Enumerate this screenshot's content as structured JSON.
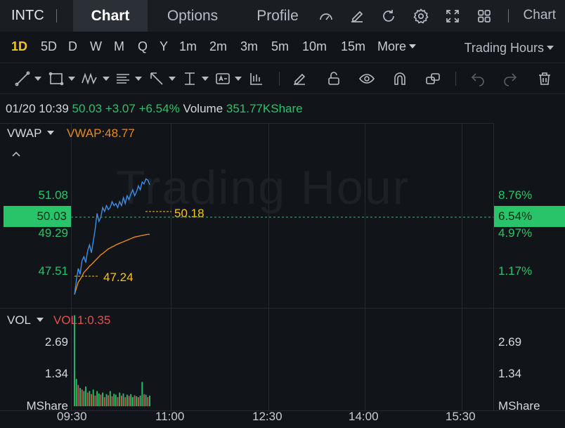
{
  "header": {
    "ticker": "INTC",
    "tabs": [
      {
        "label": "Chart",
        "active": true
      },
      {
        "label": "Options",
        "active": false
      },
      {
        "label": "Profile",
        "active": false
      }
    ],
    "right_label": "Chart",
    "icons": [
      "gauge-icon",
      "edit-icon",
      "refresh-icon",
      "settings-icon",
      "fullscreen-icon",
      "grid-icon"
    ]
  },
  "periods": {
    "items": [
      "1D",
      "5D",
      "D",
      "W",
      "M",
      "Q",
      "Y",
      "1m",
      "2m",
      "3m",
      "5m",
      "10m",
      "15m"
    ],
    "active": "1D",
    "more_label": "More",
    "session_label": "Trading Hours"
  },
  "quote": {
    "datetime": "01/20 10:39",
    "price": "50.03",
    "change": "+3.07",
    "change_pct": "+6.54%",
    "volume_label": "Volume",
    "volume": "351.77KShare"
  },
  "price_panel": {
    "indicator": "VWAP",
    "indicator_value": "VWAP:48.77",
    "watermark": "Trading Hour",
    "left_axis": [
      "51.08",
      "49.29",
      "47.51"
    ],
    "right_axis": [
      "8.76%",
      "4.97%",
      "1.17%"
    ],
    "current_price": "50.03",
    "current_pct": "6.54%",
    "high_marker": "50.18",
    "low_marker": "47.24"
  },
  "volume_panel": {
    "indicator": "VOL",
    "indicator_value": "VOL1:0.35",
    "left_axis": [
      "2.69",
      "1.34",
      "MShare"
    ],
    "right_axis": [
      "2.69",
      "1.34",
      "MShare"
    ]
  },
  "time_axis": [
    "09:30",
    "11:00",
    "12:30",
    "14:00",
    "15:30"
  ],
  "colors": {
    "up": "#29c46a",
    "down": "#e0524f",
    "price_line": "#3b8ee8",
    "vwap_line": "#e88a1a",
    "marker": "#f5c518",
    "active_period": "#f5c518"
  },
  "chart_data": {
    "type": "line",
    "price_range": [
      46.9,
      51.6
    ],
    "volume_range": [
      0,
      3.2
    ],
    "series": [
      {
        "key": "price",
        "values": [
          47.24,
          47.6,
          47.9,
          47.75,
          48.1,
          48.2,
          48.05,
          48.35,
          48.5,
          48.3,
          48.6,
          48.9,
          49.3,
          49.1,
          49.2,
          49.45,
          49.35,
          49.5,
          49.4,
          49.45,
          49.6,
          49.5,
          49.55,
          49.45,
          49.6,
          49.5,
          49.7,
          49.55,
          49.75,
          49.65,
          49.8,
          49.9,
          49.75,
          49.85,
          50.0,
          49.9,
          50.1,
          50.05,
          50.18,
          50.15,
          50.03
        ]
      },
      {
        "key": "vwap",
        "values": [
          47.24,
          47.4,
          47.55,
          47.62,
          47.7,
          47.8,
          47.85,
          47.9,
          47.96,
          48.0,
          48.05,
          48.1,
          48.15,
          48.2,
          48.25,
          48.28,
          48.32,
          48.36,
          48.4,
          48.42,
          48.45,
          48.47,
          48.5,
          48.52,
          48.54,
          48.56,
          48.58,
          48.6,
          48.62,
          48.64,
          48.66,
          48.68,
          48.7,
          48.71,
          48.72,
          48.73,
          48.74,
          48.75,
          48.76,
          48.77,
          48.77
        ]
      }
    ],
    "volume": [
      3.0,
      0.9,
      0.7,
      0.6,
      0.55,
      0.5,
      0.65,
      0.45,
      0.5,
      0.4,
      0.55,
      0.35,
      0.5,
      0.42,
      0.38,
      0.45,
      0.3,
      0.4,
      0.36,
      0.5,
      0.33,
      0.41,
      0.38,
      0.3,
      0.45,
      0.35,
      0.42,
      0.3,
      0.38,
      0.34,
      0.4,
      0.3,
      0.36,
      0.33,
      0.3,
      0.35,
      0.8,
      0.4,
      0.38,
      0.3,
      0.35
    ],
    "volume_up": [
      1,
      1,
      0,
      1,
      0,
      1,
      1,
      0,
      1,
      0,
      1,
      0,
      1,
      1,
      0,
      1,
      0,
      1,
      0,
      1,
      0,
      1,
      1,
      0,
      1,
      0,
      1,
      0,
      1,
      0,
      1,
      1,
      0,
      1,
      0,
      1,
      1,
      0,
      1,
      0,
      1
    ]
  }
}
